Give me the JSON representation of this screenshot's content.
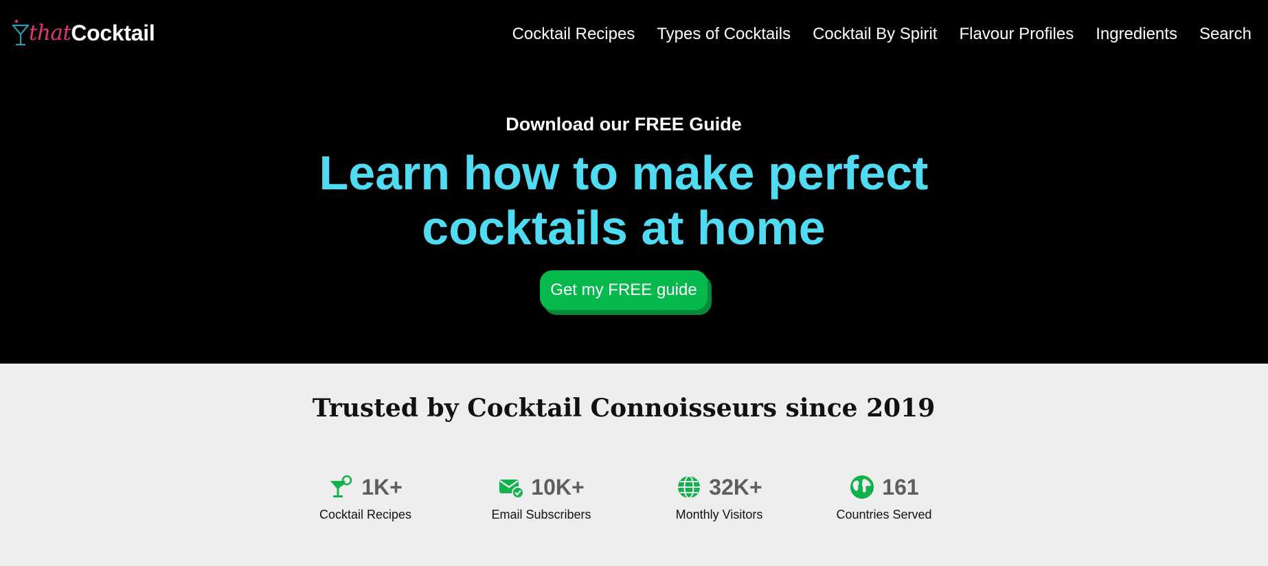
{
  "header": {
    "logo": {
      "that": "that",
      "cocktail": "Cocktail"
    },
    "nav": [
      "Cocktail Recipes",
      "Types of Cocktails",
      "Cocktail By Spirit",
      "Flavour Profiles",
      "Ingredients",
      "Search"
    ]
  },
  "hero": {
    "kicker": "Download our FREE Guide",
    "title_line1": "Learn how to make perfect",
    "title_line2": "cocktails at home",
    "cta_label": "Get my FREE guide"
  },
  "trust": {
    "title": "Trusted by Cocktail Connoisseurs since 2019",
    "stats": [
      {
        "icon": "cocktail-glass-icon",
        "value": "1K+",
        "label": "Cocktail Recipes"
      },
      {
        "icon": "email-check-icon",
        "value": "10K+",
        "label": "Email Subscribers"
      },
      {
        "icon": "globe-icon",
        "value": "32K+",
        "label": "Monthly Visitors"
      },
      {
        "icon": "earth-icon",
        "value": "161",
        "label": "Countries Served"
      }
    ]
  },
  "colors": {
    "header_bg": "#000000",
    "logo_that": "#e0347a",
    "hero_title": "#4fdcf2",
    "cta_green": "#06b94c",
    "icon_green": "#10b24c",
    "stat_value": "#5e5e5e",
    "trust_bg": "#eeeeee"
  }
}
